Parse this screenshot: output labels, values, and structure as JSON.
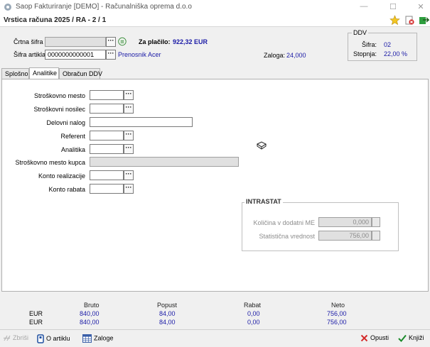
{
  "window": {
    "app_title": "Saop Fakturiranje [DEMO] - Računalniška oprema d.o.o",
    "doc_title": "Vrstica računa  2025 / RA - 2 / 1"
  },
  "header": {
    "crtna_sifra_label": "Črtna šifra",
    "crtna_sifra_value": "",
    "sifra_artikla_label": "Šifra artikla",
    "sifra_artikla_value": "0000000000001",
    "article_name": "Prenosnik Acer",
    "za_placilo_label": "Za plačilo:",
    "za_placilo_value": "922,32 EUR",
    "zaloga_label": "Zaloga:",
    "zaloga_value": "24,000"
  },
  "ddv": {
    "legend": "DDV",
    "sifra_label": "Šifra:",
    "sifra_value": "02",
    "stopnja_label": "Stopnja:",
    "stopnja_value": "22,00 %"
  },
  "tabs": [
    {
      "label": "Splošno",
      "active": false
    },
    {
      "label": "Analitike",
      "active": true
    },
    {
      "label": "Obračun DDV",
      "active": false
    }
  ],
  "analitike": {
    "strosk_mesto": "Stroškovno mesto",
    "strosk_nosilec": "Stroškovni  nosilec",
    "delovni_nalog": "Delovni nalog",
    "referent": "Referent",
    "analitika": "Analitika",
    "strosk_mesto_kupca": "Stroškovno mesto kupca",
    "konto_realizacije": "Konto realizacije",
    "konto_rabata": "Konto rabata"
  },
  "intrastat": {
    "legend": "INTRASTAT",
    "kolicina_label": "Količina v dodatni ME",
    "kolicina_value": "0,000",
    "stat_label": "Statistična vrednost",
    "stat_value": "756,00"
  },
  "totals": {
    "headers": [
      "Bruto",
      "Popust",
      "Rabat",
      "Neto"
    ],
    "rows": [
      {
        "currency": "EUR",
        "bruto": "840,00",
        "popust": "84,00",
        "rabat": "0,00",
        "neto": "756,00"
      },
      {
        "currency": "EUR",
        "bruto": "840,00",
        "popust": "84,00",
        "rabat": "0,00",
        "neto": "756,00"
      }
    ]
  },
  "bottom": {
    "zbrisi": "Zbriši",
    "o_artiklu": "O artiklu",
    "zaloge": "Zaloge",
    "opusti": "Opusti",
    "knjizi": "Knjiži"
  },
  "colors": {
    "accent_blue": "#1a1aa6",
    "cancel_red": "#d42a2a",
    "confirm_green": "#1a8a2a"
  }
}
